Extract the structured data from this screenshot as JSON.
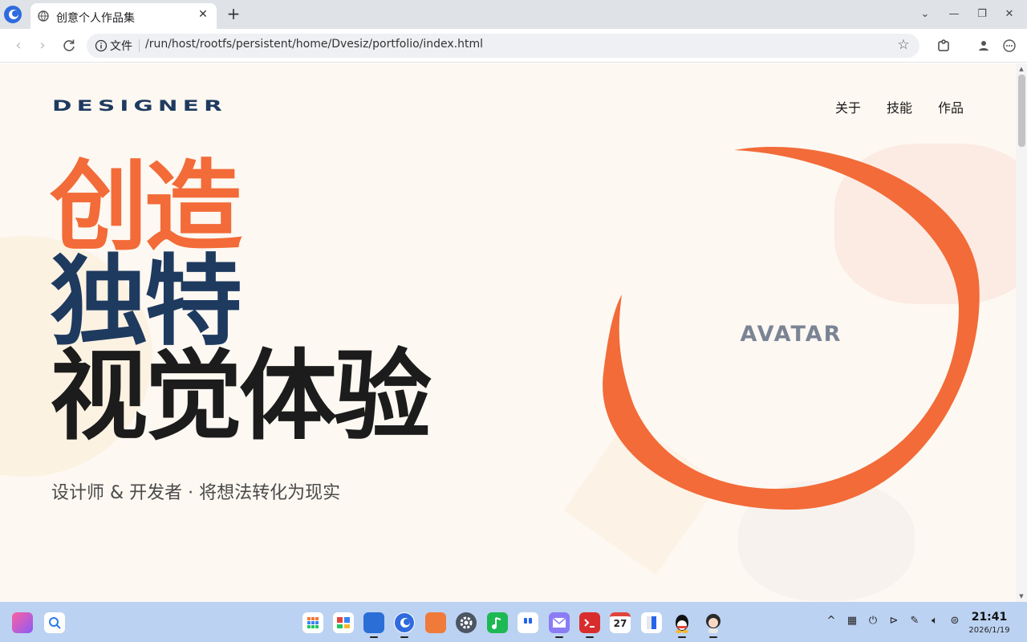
{
  "browser": {
    "tab_title": "创意个人作品集",
    "tab_close": "✕",
    "new_tab": "+",
    "address_scheme": "文件",
    "address_url": "/run/host/rootfs/persistent/home/Dvesiz/portfolio/index.html",
    "window_controls": {
      "dropdown": "⌄",
      "minimize": "—",
      "maximize": "❐",
      "close": "✕"
    }
  },
  "page": {
    "logo": "DESIGNER",
    "nav": [
      "关于",
      "技能",
      "作品"
    ],
    "hero": {
      "line1": "创造",
      "line2": "独特",
      "line3": "视觉体验"
    },
    "subtitle": "设计师 & 开发者 · 将想法转化为现实",
    "avatar_label": "AVATAR",
    "colors": {
      "accent": "#f26b38",
      "navy": "#1e3a5f",
      "ink": "#1c1c1c",
      "background": "#fdf8f2"
    }
  },
  "taskbar": {
    "apps": [
      "launcher-icon",
      "search-icon",
      "app-grid-icon",
      "store-icon",
      "files-icon",
      "browser-icon",
      "shop-icon",
      "settings-icon",
      "music-icon",
      "quote-icon",
      "mail-icon",
      "terminal-icon",
      "calendar-icon",
      "calculator-icon",
      "qq-icon",
      "avatar-app-icon"
    ],
    "calendar_day": "27",
    "tray_chevron": "^",
    "time": "21:41",
    "date": "2026/1/19"
  }
}
